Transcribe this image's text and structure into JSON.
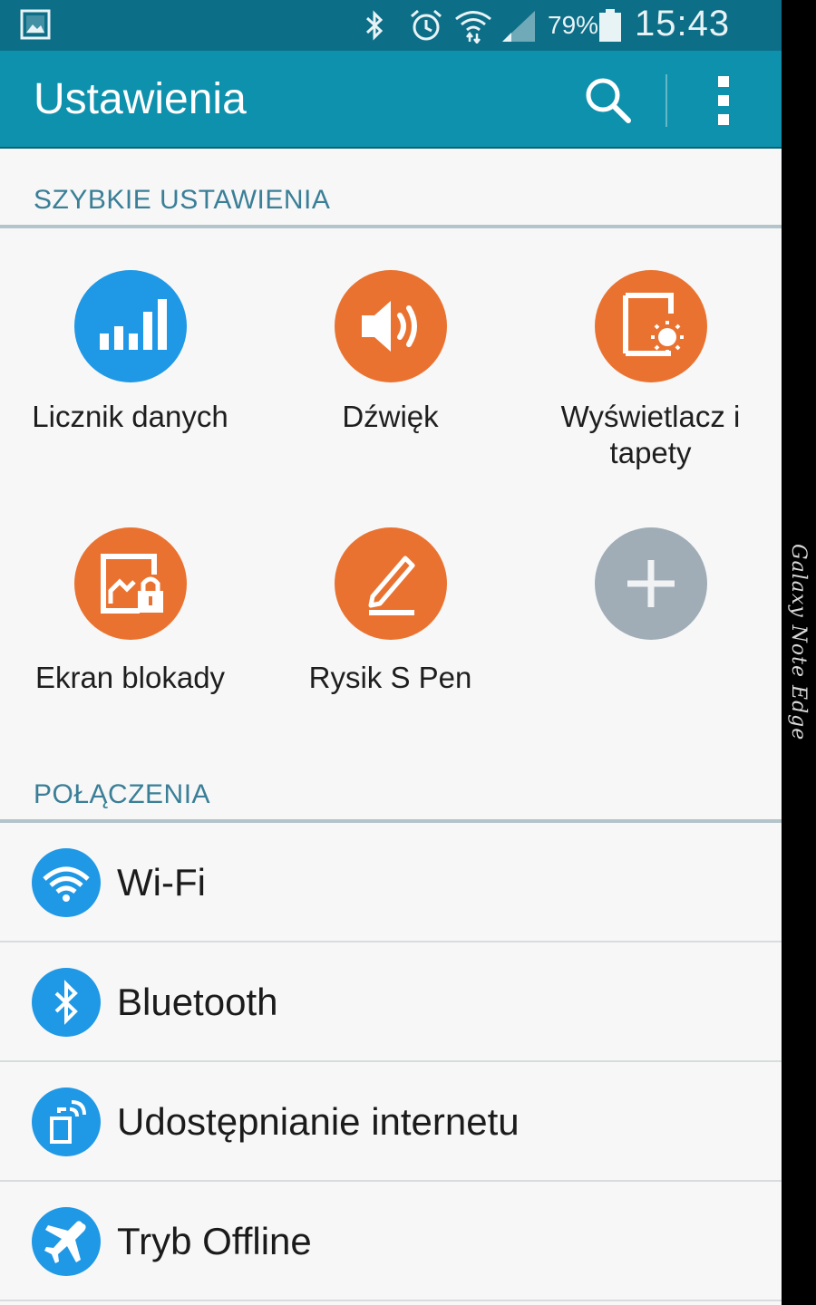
{
  "status_bar": {
    "battery_percent": "79%",
    "time": "15:43",
    "icons": [
      "gallery-icon",
      "bluetooth-icon",
      "alarm-icon",
      "wifi-icon",
      "signal-icon",
      "battery-icon"
    ]
  },
  "action_bar": {
    "title": "Ustawienia",
    "actions": [
      "search-icon",
      "more-options-icon"
    ]
  },
  "quick_settings": {
    "header": "SZYBKIE USTAWIENIA",
    "tiles": [
      {
        "label": "Licznik danych",
        "icon": "data-usage-icon",
        "color": "#1f98e6"
      },
      {
        "label": "Dźwięk",
        "icon": "sound-icon",
        "color": "#ea7230"
      },
      {
        "label_line1": "Wyświetlacz i",
        "label_line2": "tapety",
        "icon": "display-wallpaper-icon",
        "color": "#ea7230"
      },
      {
        "label": "Ekran blokady",
        "icon": "lock-screen-icon",
        "color": "#ea7230"
      },
      {
        "label": "Rysik S Pen",
        "icon": "s-pen-icon",
        "color": "#ea7230"
      },
      {
        "icon": "add-icon",
        "color": "#a0adb6"
      }
    ]
  },
  "connections": {
    "header": "POŁĄCZENIA",
    "items": [
      {
        "label": "Wi-Fi",
        "icon": "wifi-icon"
      },
      {
        "label": "Bluetooth",
        "icon": "bluetooth-icon"
      },
      {
        "label": "Udostępnianie internetu",
        "icon": "tethering-icon"
      },
      {
        "label": "Tryb Offline",
        "icon": "airplane-icon"
      }
    ]
  },
  "device_edge": {
    "label": "Galaxy Note Edge"
  },
  "colors": {
    "status_bar": "#0d6e87",
    "action_bar": "#0e91ad",
    "section_header_text": "#3a7f97",
    "accent_blue": "#1f98e6",
    "accent_orange": "#ea7230",
    "add_gray": "#a0adb6"
  }
}
